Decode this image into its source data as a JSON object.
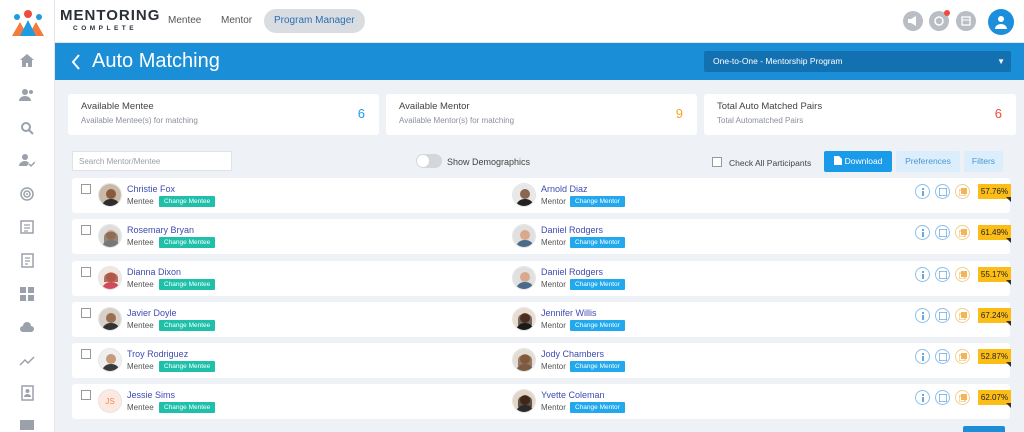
{
  "brand": {
    "name": "MENTORING",
    "sub": "COMPLETE"
  },
  "top_tabs": [
    {
      "label": "Mentee",
      "active": false
    },
    {
      "label": "Mentor",
      "active": false
    },
    {
      "label": "Program Manager",
      "active": true
    }
  ],
  "header": {
    "title": "Auto Matching",
    "program": "One-to-One - Mentorship Program"
  },
  "stats": [
    {
      "title": "Available Mentee",
      "sub": "Available Mentee(s) for matching",
      "value": "6",
      "color": "#1a9bea"
    },
    {
      "title": "Available Mentor",
      "sub": "Available Mentor(s) for matching",
      "value": "9",
      "color": "#f5a623"
    },
    {
      "title": "Total Auto Matched Pairs",
      "sub": "Total Automatched Pairs",
      "value": "6",
      "color": "#f04a3b"
    }
  ],
  "toolbar": {
    "search_placeholder": "Search Mentor/Mentee",
    "show_demographics": "Show Demographics",
    "check_all": "Check All Participants",
    "download": "Download",
    "preferences": "Preferences",
    "filters": "Filters"
  },
  "labels": {
    "mentee": "Mentee",
    "mentor": "Mentor",
    "change_mentee": "Change Mentee",
    "change_mentor": "Change Mentor"
  },
  "pairs": [
    {
      "mentee": "Christie Fox",
      "mentor": "Arnold Diaz",
      "match": "57.76%"
    },
    {
      "mentee": "Rosemary Bryan",
      "mentor": "Daniel Rodgers",
      "match": "61.49%"
    },
    {
      "mentee": "Dianna Dixon",
      "mentor": "Daniel Rodgers",
      "match": "55.17%"
    },
    {
      "mentee": "Javier Doyle",
      "mentor": "Jennifer Willis",
      "match": "67.24%"
    },
    {
      "mentee": "Troy Rodriguez",
      "mentor": "Jody Chambers",
      "match": "52.87%"
    },
    {
      "mentee": "Jessie Sims",
      "mentee_initials": "JS",
      "mentor": "Yvette Coleman",
      "match": "62.07%"
    }
  ],
  "colors": {
    "accent": "#1a8ed6",
    "mentee_btn": "#1ec0a9",
    "mentor_btn": "#22a8ec",
    "badge": "#fbbd16"
  }
}
